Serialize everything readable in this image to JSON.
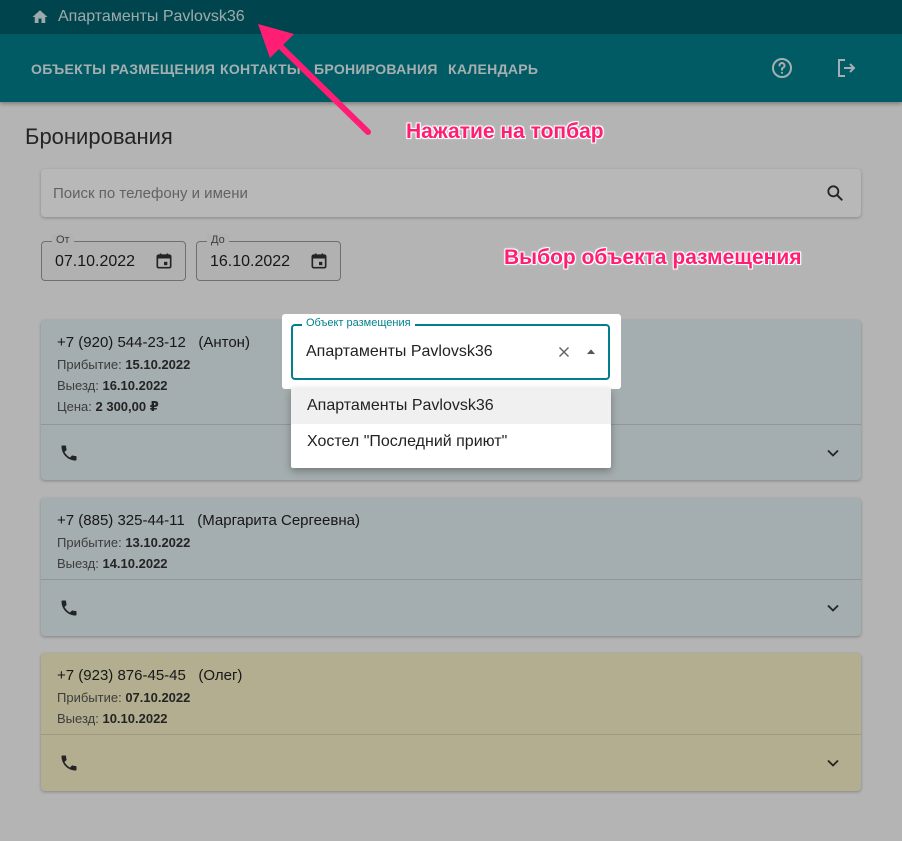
{
  "topbar": {
    "title": "Апартаменты Pavlovsk36",
    "icon": "home-icon"
  },
  "nav": {
    "items": [
      "ОБЪЕКТЫ РАЗМЕЩЕНИЯ",
      "КОНТАКТЫ",
      "БРОНИРОВАНИЯ",
      "КАЛЕНДАРЬ"
    ],
    "help_icon": "help-icon",
    "logout_icon": "logout-icon"
  },
  "page": {
    "title": "Бронирования"
  },
  "search": {
    "placeholder": "Поиск по телефону и имени",
    "value": ""
  },
  "dates": {
    "from": {
      "label": "От",
      "value": "07.10.2022"
    },
    "to": {
      "label": "До",
      "value": "16.10.2022"
    }
  },
  "bookings": [
    {
      "phone": "+7 (920) 544-23-12",
      "name": "(Антон)",
      "arrival_label": "Прибытие:",
      "arrival": "15.10.2022",
      "departure_label": "Выезд:",
      "departure": "16.10.2022",
      "price_label": "Цена:",
      "price": "2 300,00 ₽",
      "bg": "#e3f0f3"
    },
    {
      "phone": "+7 (885) 325-44-11",
      "name": "(Маргарита Сергеевна)",
      "arrival_label": "Прибытие:",
      "arrival": "13.10.2022",
      "departure_label": "Выезд:",
      "departure": "14.10.2022",
      "bg": "#e3f0f3"
    },
    {
      "phone": "+7 (923) 876-45-45",
      "name": "(Олег)",
      "arrival_label": "Прибытие:",
      "arrival": "07.10.2022",
      "departure_label": "Выезд:",
      "departure": "10.10.2022",
      "bg": "#f7f2c6"
    }
  ],
  "object_select": {
    "label": "Объект размещения",
    "value": "Апартаменты Pavlovsk36",
    "options": [
      "Апартаменты Pavlovsk36",
      "Хостел \"Последний приют\""
    ]
  },
  "annotations": {
    "topbar_note": "Нажатие на топбар",
    "select_note": "Выбор объекта размещения"
  },
  "colors": {
    "topbar": "#00606d",
    "navbar": "#017f8c",
    "annotation": "#ff1e73"
  }
}
